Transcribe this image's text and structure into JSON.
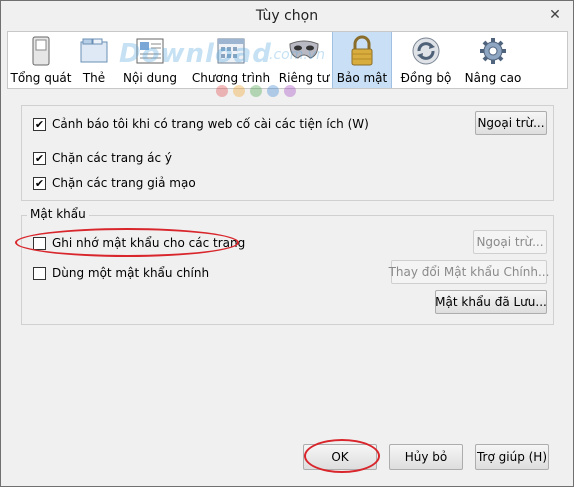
{
  "window": {
    "title": "Tùy chọn",
    "close_symbol": "✕"
  },
  "tabs": [
    {
      "label": "Tổng quát",
      "icon": "switch-icon"
    },
    {
      "label": "Thẻ",
      "icon": "tabs-icon"
    },
    {
      "label": "Nội dung",
      "icon": "content-icon"
    },
    {
      "label": "Chương trình",
      "icon": "applications-icon"
    },
    {
      "label": "Riêng tư",
      "icon": "mask-icon"
    },
    {
      "label": "Bảo mật",
      "icon": "padlock-icon"
    },
    {
      "label": "Đồng bộ",
      "icon": "sync-icon"
    },
    {
      "label": "Nâng cao",
      "icon": "gear-icon"
    }
  ],
  "active_tab": "Bảo mật",
  "watermark": {
    "text": "Download",
    "suffix": ".com.vn"
  },
  "security": {
    "warn_addons": {
      "label": "Cảnh báo tôi khi có trang web cố cài các tiện ích (W)",
      "checked": true
    },
    "warn_exceptions_button": "Ngoại trừ...",
    "block_attack": {
      "label": "Chặn các trang ác ý",
      "checked": true
    },
    "block_forgery": {
      "label": "Chặn các trang giả mạo",
      "checked": true
    }
  },
  "passwords": {
    "group_title": "Mật khẩu",
    "remember": {
      "label": "Ghi nhớ mật khẩu cho các trang",
      "checked": false
    },
    "exceptions_button": "Ngoại trừ...",
    "master": {
      "label": "Dùng một mật khẩu chính",
      "checked": false
    },
    "change_master_button": "Thay đổi Mật khẩu Chính...",
    "saved_button": "Mật khẩu đã Lưu..."
  },
  "footer": {
    "ok": "OK",
    "cancel": "Hủy bỏ",
    "help": "Trợ giúp (H)"
  },
  "colors": {
    "highlight": "#d8262c",
    "active_tab": "#c9dff5"
  }
}
